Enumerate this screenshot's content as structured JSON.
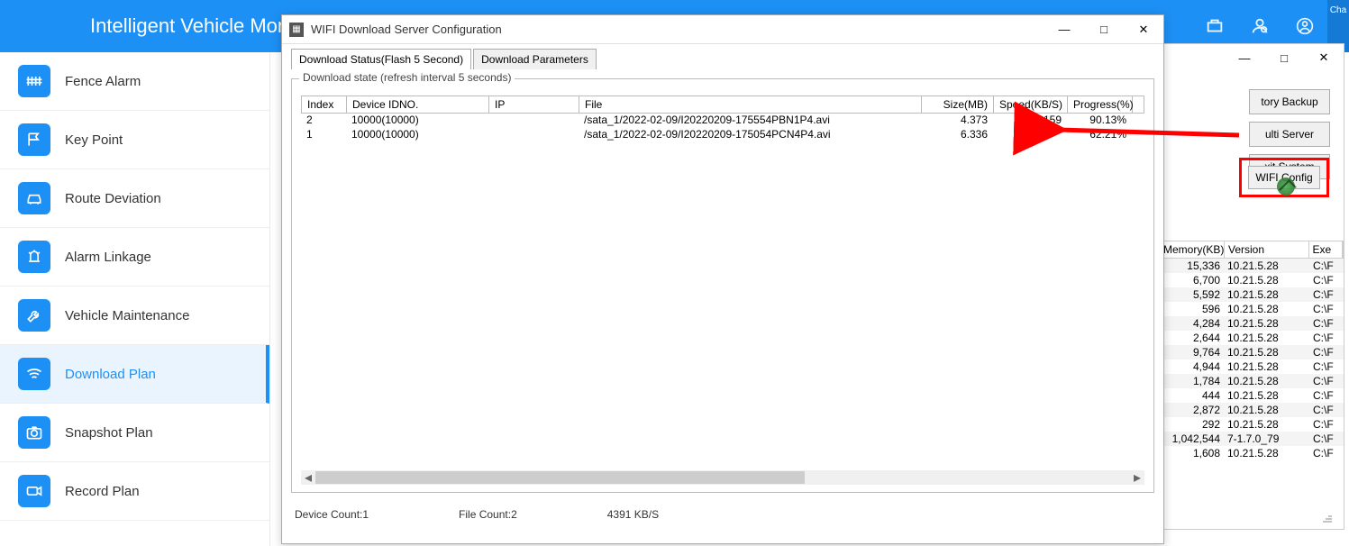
{
  "header": {
    "title": "Intelligent Vehicle Moni",
    "chat": "Cha"
  },
  "sidebar": {
    "items": [
      {
        "label": "Fence Alarm"
      },
      {
        "label": "Key Point"
      },
      {
        "label": "Route Deviation"
      },
      {
        "label": "Alarm Linkage"
      },
      {
        "label": "Vehicle Maintenance"
      },
      {
        "label": "Download Plan"
      },
      {
        "label": "Snapshot Plan"
      },
      {
        "label": "Record Plan"
      }
    ],
    "active_index": 5
  },
  "bg_window": {
    "buttons": {
      "history_backup": "tory Backup",
      "multi_server": "ulti Server",
      "exit_system": "xit System",
      "wifi_config": "WIFI Config"
    },
    "table": {
      "headers": {
        "memory": "Memory(KB)",
        "version": "Version",
        "exe": "Exe"
      },
      "rows": [
        {
          "mem": "15,336",
          "ver": "10.21.5.28",
          "exe": "C:\\F"
        },
        {
          "mem": "6,700",
          "ver": "10.21.5.28",
          "exe": "C:\\F"
        },
        {
          "mem": "5,592",
          "ver": "10.21.5.28",
          "exe": "C:\\F"
        },
        {
          "mem": "596",
          "ver": "10.21.5.28",
          "exe": "C:\\F"
        },
        {
          "mem": "4,284",
          "ver": "10.21.5.28",
          "exe": "C:\\F"
        },
        {
          "mem": "2,644",
          "ver": "10.21.5.28",
          "exe": "C:\\F"
        },
        {
          "mem": "9,764",
          "ver": "10.21.5.28",
          "exe": "C:\\F"
        },
        {
          "mem": "4,944",
          "ver": "10.21.5.28",
          "exe": "C:\\F"
        },
        {
          "mem": "1,784",
          "ver": "10.21.5.28",
          "exe": "C:\\F"
        },
        {
          "mem": "444",
          "ver": "10.21.5.28",
          "exe": "C:\\F"
        },
        {
          "mem": "2,872",
          "ver": "10.21.5.28",
          "exe": "C:\\F"
        },
        {
          "mem": "292",
          "ver": "10.21.5.28",
          "exe": "C:\\F"
        },
        {
          "mem": "1,042,544",
          "ver": "7-1.7.0_79",
          "exe": "C:\\F"
        },
        {
          "mem": "1,608",
          "ver": "10.21.5.28",
          "exe": "C:\\F"
        }
      ]
    }
  },
  "dialog": {
    "title": "WIFI Download Server Configuration",
    "tabs": [
      {
        "label": "Download Status(Flash 5 Second)"
      },
      {
        "label": "Download Parameters"
      }
    ],
    "group_legend": "Download state (refresh interval 5 seconds)",
    "grid": {
      "headers": {
        "index": "Index",
        "device": "Device IDNO.",
        "ip": "IP",
        "file": "File",
        "size": "Size(MB)",
        "speed": "Speed(KB/S)",
        "progress": "Progress(%)"
      },
      "rows": [
        {
          "index": "2",
          "device": "10000(10000)",
          "ip": "",
          "file": "/sata_1/2022-02-09/I20220209-175554PBN1P4.avi",
          "size": "4.373",
          "speed": "2159",
          "progress": "90.13%"
        },
        {
          "index": "1",
          "device": "10000(10000)",
          "ip": "",
          "file": "/sata_1/2022-02-09/I20220209-175054PCN4P4.avi",
          "size": "6.336",
          "speed": "",
          "progress": "62.21%"
        }
      ]
    },
    "footer": {
      "device_count": "Device Count:1",
      "file_count": "File Count:2",
      "speed": "4391 KB/S"
    }
  }
}
